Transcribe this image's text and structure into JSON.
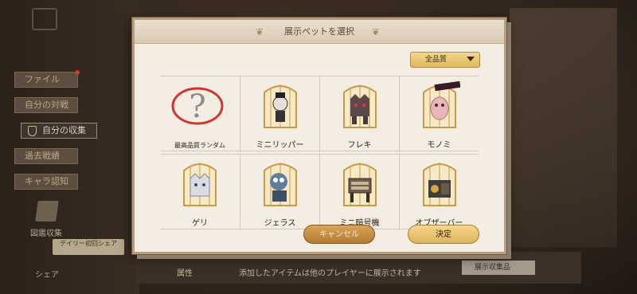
{
  "background": {
    "sidebar": {
      "items": [
        {
          "label": "ファイル"
        },
        {
          "label": "自分の対戦"
        },
        {
          "label": "自分の収集"
        },
        {
          "label": "過去戦績"
        },
        {
          "label": "キャラ認知"
        }
      ],
      "book_label": "図鑑収集",
      "share_label": "シェア",
      "share_badge": "デイリー初回シェア"
    },
    "bottom": {
      "tab_label": "属性",
      "notice": "添加したアイテムは他のプレイヤーに展示されます",
      "collect_button": "展示収集品"
    }
  },
  "modal": {
    "title": "展示ペットを選択",
    "quality_filter": "全品質",
    "pets": [
      {
        "name": "最高品質ランダム",
        "icon": "random-question-icon",
        "color": "#d0352f"
      },
      {
        "name": "ミニリッパー",
        "icon": "mini-ripper-pet-icon",
        "color": "#e6e0d6"
      },
      {
        "name": "フレキ",
        "icon": "freki-wolf-pet-icon",
        "color": "#5a4a4a"
      },
      {
        "name": "モノミ",
        "icon": "monomi-pet-icon",
        "color": "#e9b7b7"
      },
      {
        "name": "ゲリ",
        "icon": "geri-wolf-pet-icon",
        "color": "#d9dde2"
      },
      {
        "name": "ジェラス",
        "icon": "jealous-doll-pet-icon",
        "color": "#5f7f9c"
      },
      {
        "name": "ミニ暗号機",
        "icon": "mini-cipher-machine-pet-icon",
        "color": "#6b5c4d"
      },
      {
        "name": "オブザーバー",
        "icon": "observer-pet-icon",
        "color": "#3e3e3e"
      }
    ],
    "cancel_label": "キャンセル",
    "confirm_label": "決定"
  }
}
